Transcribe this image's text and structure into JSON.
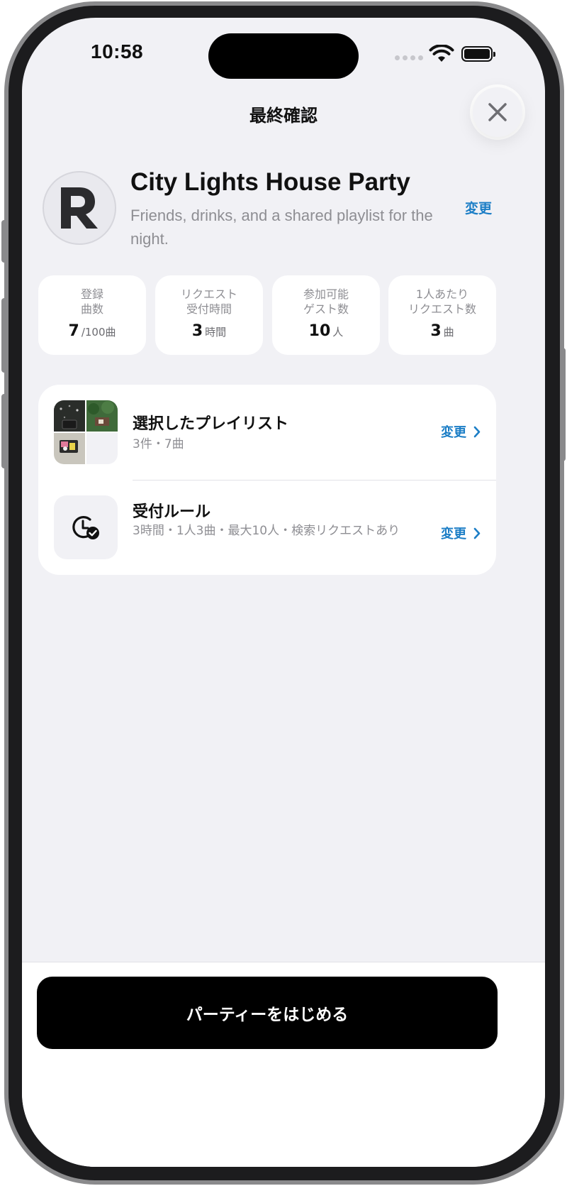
{
  "status_bar": {
    "time": "10:58"
  },
  "sheet": {
    "title": "最終確認"
  },
  "party": {
    "name": "City Lights House Party",
    "description": "Friends, drinks, and a shared playlist for the night.",
    "edit_label": "変更"
  },
  "stats": [
    {
      "label": "登録\n曲数",
      "value": "7",
      "unit": "/100曲"
    },
    {
      "label": "リクエスト\n受付時間",
      "value": "3",
      "unit": "時間"
    },
    {
      "label": "参加可能\nゲスト数",
      "value": "10",
      "unit": "人"
    },
    {
      "label": "1人あたり\nリクエスト数",
      "value": "3",
      "unit": "曲"
    }
  ],
  "settings": {
    "playlist": {
      "title": "選択したプレイリスト",
      "subtitle": "3件・7曲",
      "edit_label": "変更"
    },
    "rules": {
      "title": "受付ルール",
      "subtitle": "3時間・1人3曲・最大10人・検索リクエストあり",
      "edit_label": "変更"
    }
  },
  "footer": {
    "start_button_label": "パーティーをはじめる"
  },
  "colors": {
    "accent": "#1c7ec6",
    "background": "#f1f1f5",
    "card": "#ffffff",
    "primary_button": "#000000"
  },
  "icons": {
    "close": "close-icon",
    "logo": "r-logo-icon",
    "chevron": "chevron-right-icon",
    "clock_check": "clock-check-icon",
    "wifi": "wifi-icon",
    "battery": "battery-icon"
  }
}
